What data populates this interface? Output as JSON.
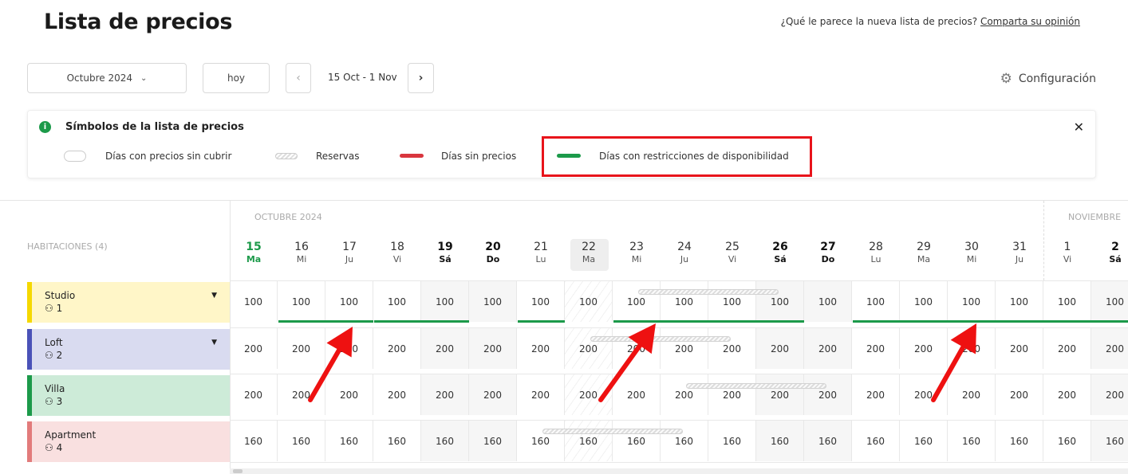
{
  "header": {
    "title": "Lista de precios",
    "feedback_prompt": "¿Qué le parece la nueva lista de precios?",
    "feedback_link": "Comparta su opinión"
  },
  "toolbar": {
    "month_select": "Octubre 2024",
    "today_label": "hoy",
    "range_label": "15 Oct - 1 Nov",
    "config_label": "Configuración"
  },
  "legend": {
    "title": "Símbolos de la lista de precios",
    "items": [
      "Días con precios sin cubrir",
      "Reservas",
      "Días sin precios",
      "Días con restricciones de disponibilidad"
    ]
  },
  "grid": {
    "rooms_header": "HABITACIONES (4)",
    "months": [
      "OCTUBRE 2024",
      "NOVIEMBRE"
    ],
    "days": [
      {
        "num": "15",
        "wd": "Ma",
        "type": "today"
      },
      {
        "num": "16",
        "wd": "Mi",
        "type": ""
      },
      {
        "num": "17",
        "wd": "Ju",
        "type": ""
      },
      {
        "num": "18",
        "wd": "Vi",
        "type": ""
      },
      {
        "num": "19",
        "wd": "Sá",
        "type": "we"
      },
      {
        "num": "20",
        "wd": "Do",
        "type": "we"
      },
      {
        "num": "21",
        "wd": "Lu",
        "type": ""
      },
      {
        "num": "22",
        "wd": "Ma",
        "type": "sel"
      },
      {
        "num": "23",
        "wd": "Mi",
        "type": ""
      },
      {
        "num": "24",
        "wd": "Ju",
        "type": ""
      },
      {
        "num": "25",
        "wd": "Vi",
        "type": ""
      },
      {
        "num": "26",
        "wd": "Sá",
        "type": "we"
      },
      {
        "num": "27",
        "wd": "Do",
        "type": "we"
      },
      {
        "num": "28",
        "wd": "Lu",
        "type": ""
      },
      {
        "num": "29",
        "wd": "Ma",
        "type": ""
      },
      {
        "num": "30",
        "wd": "Mi",
        "type": ""
      },
      {
        "num": "31",
        "wd": "Ju",
        "type": ""
      },
      {
        "num": "1",
        "wd": "Vi",
        "type": ""
      },
      {
        "num": "2",
        "wd": "Sá",
        "type": "we"
      }
    ],
    "rooms": [
      {
        "name": "Studio",
        "capacity": "1",
        "color": "#fff6c8",
        "bar": "#f5d800",
        "caret": true,
        "price": "100"
      },
      {
        "name": "Loft",
        "capacity": "2",
        "color": "#d9dbf0",
        "bar": "#4a52b8",
        "caret": true,
        "price": "200"
      },
      {
        "name": "Villa",
        "capacity": "3",
        "color": "#cdebd8",
        "bar": "#1c9a4a",
        "caret": false,
        "price": "200"
      },
      {
        "name": "Apartment",
        "capacity": "4",
        "color": "#f9e0e0",
        "bar": "#e27b7b",
        "caret": false,
        "price": "160"
      }
    ]
  },
  "colors": {
    "accent": "#1c9a4a",
    "no_price": "#d9363e",
    "highlight": "#e8141b",
    "annotation_arrow": "#ee1111"
  }
}
